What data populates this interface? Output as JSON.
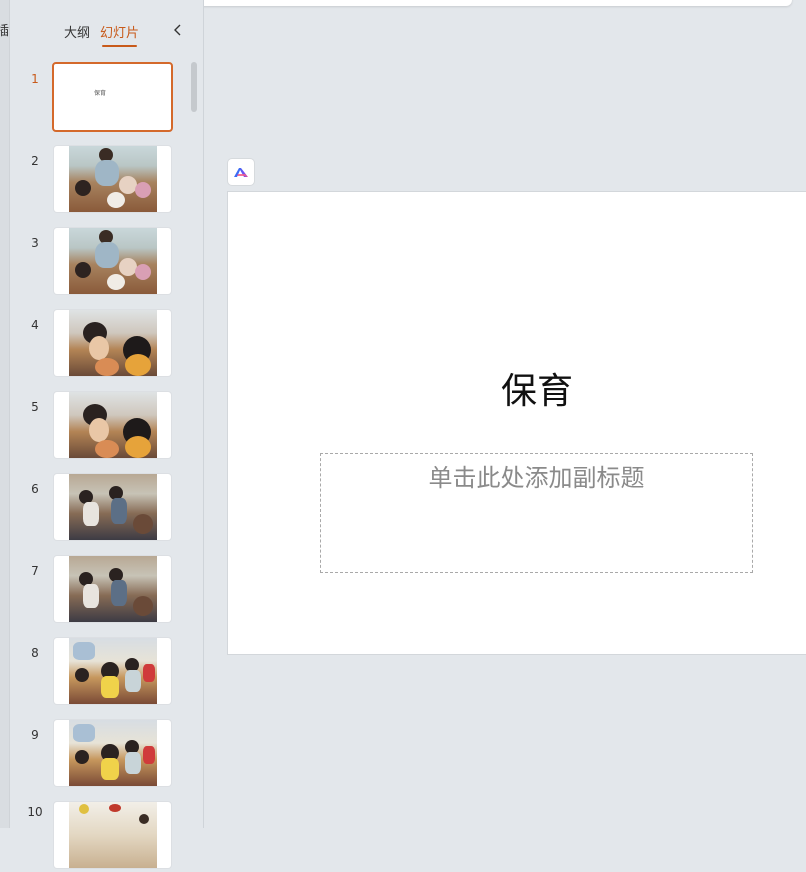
{
  "edge_char": "插",
  "sidebar": {
    "tabs": [
      {
        "label": "大纲"
      },
      {
        "label": "幻灯片"
      }
    ],
    "active_tab": "幻灯片",
    "collapse_icon": "chevron-left-icon"
  },
  "slides": [
    {
      "number": "1",
      "title": "保育"
    },
    {
      "number": "2"
    },
    {
      "number": "3"
    },
    {
      "number": "4"
    },
    {
      "number": "5"
    },
    {
      "number": "6"
    },
    {
      "number": "7"
    },
    {
      "number": "8"
    },
    {
      "number": "9"
    },
    {
      "number": "10"
    }
  ],
  "current_slide": {
    "title": "保育",
    "subtitle_placeholder": "单击此处添加副标题"
  },
  "colors": {
    "accent": "#c85a1a",
    "background": "#e3e7eb"
  }
}
